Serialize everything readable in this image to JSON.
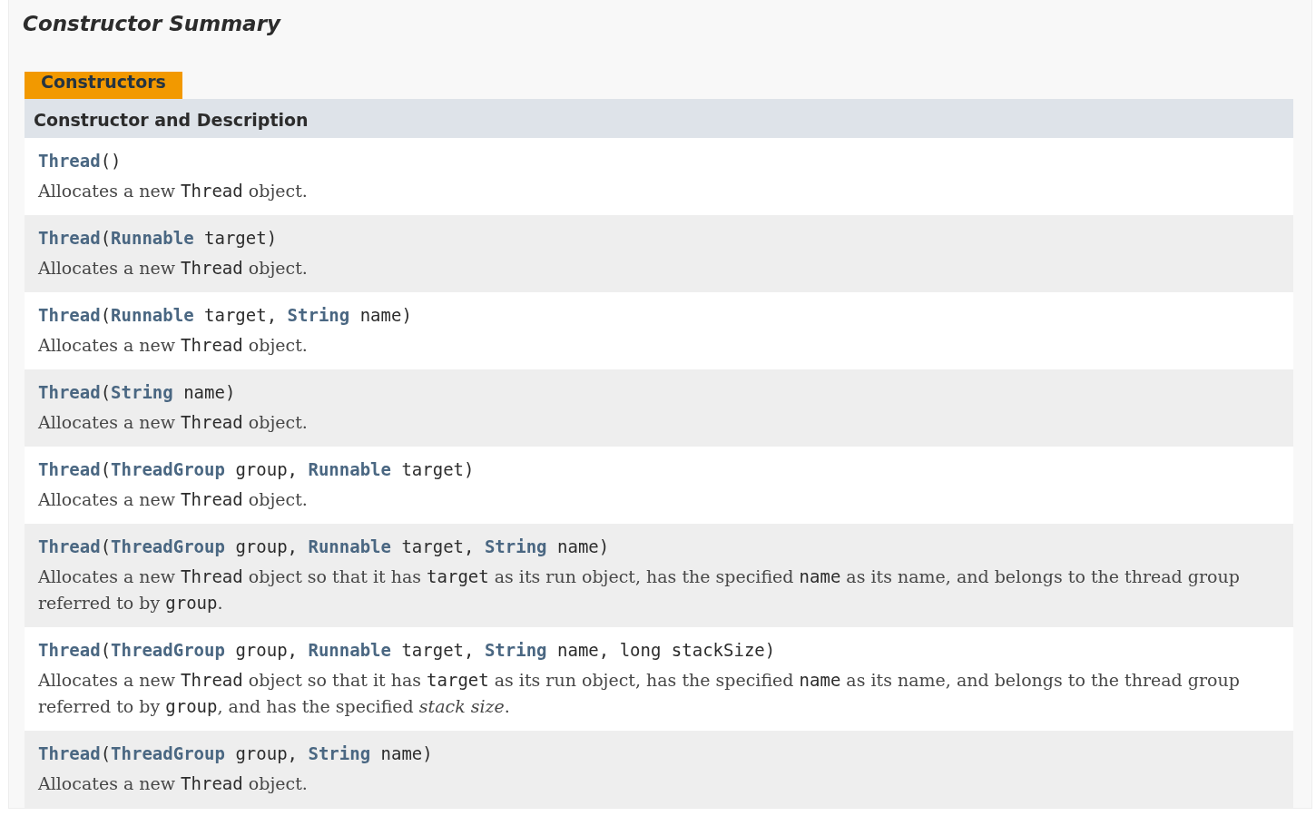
{
  "heading": "Constructor Summary",
  "tab": {
    "label": "Constructors",
    "selected": true
  },
  "table": {
    "column_header": "Constructor and Description",
    "rows": [
      {
        "signature": [
          {
            "kind": "link",
            "text": "Thread"
          },
          {
            "kind": "plain",
            "text": "()"
          }
        ],
        "description": [
          {
            "kind": "text",
            "text": "Allocates a new "
          },
          {
            "kind": "code",
            "text": "Thread"
          },
          {
            "kind": "text",
            "text": " object."
          }
        ]
      },
      {
        "signature": [
          {
            "kind": "link",
            "text": "Thread"
          },
          {
            "kind": "plain",
            "text": "("
          },
          {
            "kind": "type",
            "text": "Runnable"
          },
          {
            "kind": "plain",
            "text": " target)"
          }
        ],
        "description": [
          {
            "kind": "text",
            "text": "Allocates a new "
          },
          {
            "kind": "code",
            "text": "Thread"
          },
          {
            "kind": "text",
            "text": " object."
          }
        ]
      },
      {
        "signature": [
          {
            "kind": "link",
            "text": "Thread"
          },
          {
            "kind": "plain",
            "text": "("
          },
          {
            "kind": "type",
            "text": "Runnable"
          },
          {
            "kind": "plain",
            "text": " target, "
          },
          {
            "kind": "type",
            "text": "String"
          },
          {
            "kind": "plain",
            "text": " name)"
          }
        ],
        "description": [
          {
            "kind": "text",
            "text": "Allocates a new "
          },
          {
            "kind": "code",
            "text": "Thread"
          },
          {
            "kind": "text",
            "text": " object."
          }
        ]
      },
      {
        "signature": [
          {
            "kind": "link",
            "text": "Thread"
          },
          {
            "kind": "plain",
            "text": "("
          },
          {
            "kind": "type",
            "text": "String"
          },
          {
            "kind": "plain",
            "text": " name)"
          }
        ],
        "description": [
          {
            "kind": "text",
            "text": "Allocates a new "
          },
          {
            "kind": "code",
            "text": "Thread"
          },
          {
            "kind": "text",
            "text": " object."
          }
        ]
      },
      {
        "signature": [
          {
            "kind": "link",
            "text": "Thread"
          },
          {
            "kind": "plain",
            "text": "("
          },
          {
            "kind": "type",
            "text": "ThreadGroup"
          },
          {
            "kind": "plain",
            "text": " group, "
          },
          {
            "kind": "type",
            "text": "Runnable"
          },
          {
            "kind": "plain",
            "text": " target)"
          }
        ],
        "description": [
          {
            "kind": "text",
            "text": "Allocates a new "
          },
          {
            "kind": "code",
            "text": "Thread"
          },
          {
            "kind": "text",
            "text": " object."
          }
        ]
      },
      {
        "signature": [
          {
            "kind": "link",
            "text": "Thread"
          },
          {
            "kind": "plain",
            "text": "("
          },
          {
            "kind": "type",
            "text": "ThreadGroup"
          },
          {
            "kind": "plain",
            "text": " group, "
          },
          {
            "kind": "type",
            "text": "Runnable"
          },
          {
            "kind": "plain",
            "text": " target, "
          },
          {
            "kind": "type",
            "text": "String"
          },
          {
            "kind": "plain",
            "text": " name)"
          }
        ],
        "description": [
          {
            "kind": "text",
            "text": "Allocates a new "
          },
          {
            "kind": "code",
            "text": "Thread"
          },
          {
            "kind": "text",
            "text": " object so that it has "
          },
          {
            "kind": "code",
            "text": "target"
          },
          {
            "kind": "text",
            "text": " as its run object, has the specified "
          },
          {
            "kind": "code",
            "text": "name"
          },
          {
            "kind": "text",
            "text": " as its name, and belongs to the thread group referred to by "
          },
          {
            "kind": "code",
            "text": "group"
          },
          {
            "kind": "text",
            "text": "."
          }
        ]
      },
      {
        "signature": [
          {
            "kind": "link",
            "text": "Thread"
          },
          {
            "kind": "plain",
            "text": "("
          },
          {
            "kind": "type",
            "text": "ThreadGroup"
          },
          {
            "kind": "plain",
            "text": " group, "
          },
          {
            "kind": "type",
            "text": "Runnable"
          },
          {
            "kind": "plain",
            "text": " target, "
          },
          {
            "kind": "type",
            "text": "String"
          },
          {
            "kind": "plain",
            "text": " name, long stackSize)"
          }
        ],
        "description": [
          {
            "kind": "text",
            "text": "Allocates a new "
          },
          {
            "kind": "code",
            "text": "Thread"
          },
          {
            "kind": "text",
            "text": " object so that it has "
          },
          {
            "kind": "code",
            "text": "target"
          },
          {
            "kind": "text",
            "text": " as its run object, has the specified "
          },
          {
            "kind": "code",
            "text": "name"
          },
          {
            "kind": "text",
            "text": " as its name, and belongs to the thread group referred to by "
          },
          {
            "kind": "code",
            "text": "group"
          },
          {
            "kind": "text",
            "text": ", and has the specified "
          },
          {
            "kind": "em",
            "text": "stack size"
          },
          {
            "kind": "text",
            "text": "."
          }
        ]
      },
      {
        "signature": [
          {
            "kind": "link",
            "text": "Thread"
          },
          {
            "kind": "plain",
            "text": "("
          },
          {
            "kind": "type",
            "text": "ThreadGroup"
          },
          {
            "kind": "plain",
            "text": " group, "
          },
          {
            "kind": "type",
            "text": "String"
          },
          {
            "kind": "plain",
            "text": " name)"
          }
        ],
        "description": [
          {
            "kind": "text",
            "text": "Allocates a new "
          },
          {
            "kind": "code",
            "text": "Thread"
          },
          {
            "kind": "text",
            "text": " object."
          }
        ]
      }
    ]
  }
}
